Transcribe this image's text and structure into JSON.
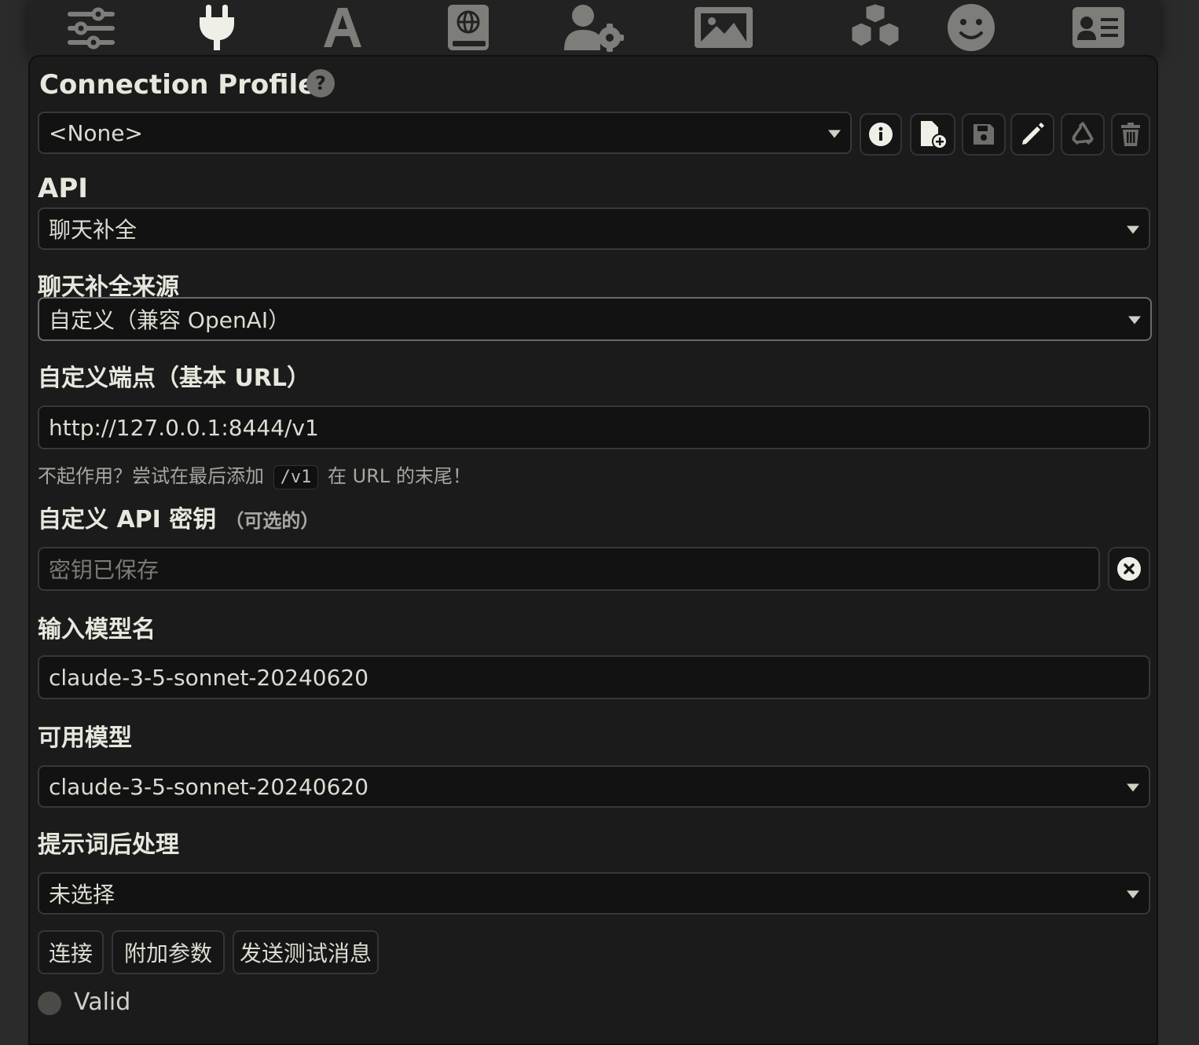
{
  "nav": {
    "icons": [
      "sliders-icon",
      "plug-icon",
      "font-icon",
      "book-globe-icon",
      "user-gear-icon",
      "image-icon",
      "cubes-icon",
      "smile-icon",
      "id-card-icon"
    ]
  },
  "connection_profile": {
    "heading": "Connection Profile",
    "help_icon": "?",
    "selected": "<None>"
  },
  "api": {
    "heading": "API",
    "selected": "聊天补全"
  },
  "chat_source": {
    "heading": "聊天补全来源",
    "selected": "自定义（兼容 OpenAI）"
  },
  "endpoint": {
    "heading": "自定义端点（基本 URL）",
    "value": "http://127.0.0.1:8444/v1",
    "hint_before": "不起作用？尝试在最后添加",
    "hint_code": "/v1",
    "hint_after": "在 URL 的末尾！"
  },
  "api_key": {
    "heading": "自定义 API 密钥",
    "optional": "（可选的）",
    "placeholder": "密钥已保存"
  },
  "model_input": {
    "heading": "输入模型名",
    "value": "claude-3-5-sonnet-20240620"
  },
  "available_models": {
    "heading": "可用模型",
    "selected": "claude-3-5-sonnet-20240620"
  },
  "post_processing": {
    "heading": "提示词后处理",
    "selected": "未选择"
  },
  "buttons": {
    "connect": "连接",
    "extra_params": "附加参数",
    "test_message": "发送测试消息"
  },
  "status": {
    "text": "Valid",
    "dot_color": "#4a4a47"
  },
  "colors": {
    "panel_bg": "#1b1b1b",
    "field_bg": "#121212",
    "text": "#dcdcd2"
  }
}
